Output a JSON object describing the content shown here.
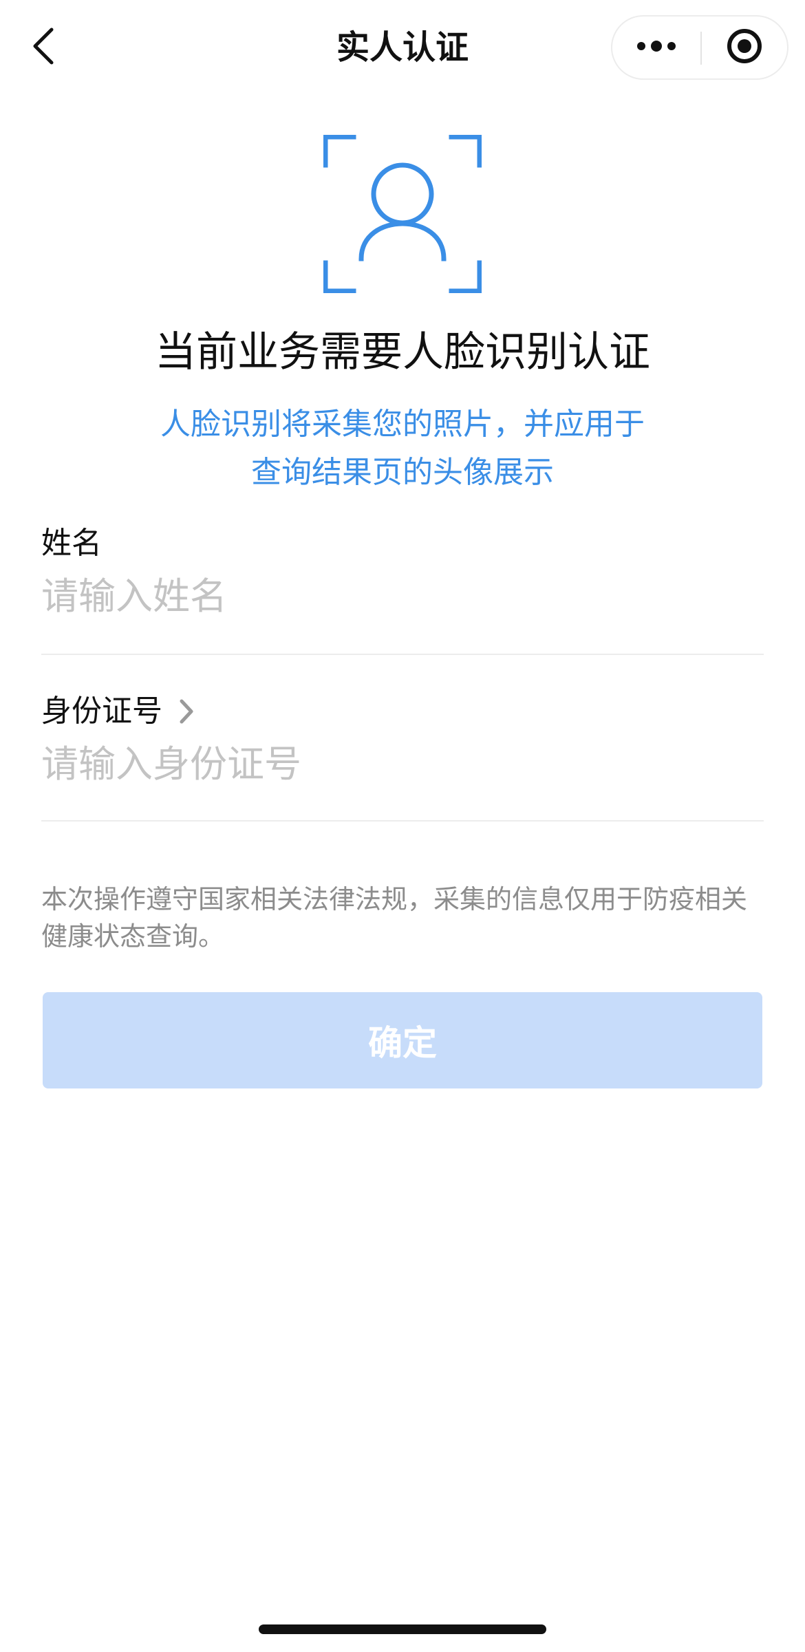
{
  "nav": {
    "title": "实人认证",
    "back_icon": "chevron-left-icon",
    "more_icon": "more-dots-icon",
    "close_icon": "target-circle-icon"
  },
  "hero": {
    "icon": "face-scan-icon",
    "accent_color": "#3a8ee6",
    "headline": "当前业务需要人脸识别认证",
    "subtext_line1": "人脸识别将采集您的照片，并应用于",
    "subtext_line2": "查询结果页的头像展示"
  },
  "form": {
    "name": {
      "label": "姓名",
      "placeholder": "请输入姓名",
      "value": ""
    },
    "id_number": {
      "label": "身份证号",
      "placeholder": "请输入身份证号",
      "value": "",
      "label_icon": "chevron-right-icon"
    }
  },
  "notice": "本次操作遵守国家相关法律法规，采集的信息仅用于防疫相关健康状态查询。",
  "confirm_button": {
    "label": "确定",
    "background": "#c7dcfa",
    "state": "disabled"
  }
}
